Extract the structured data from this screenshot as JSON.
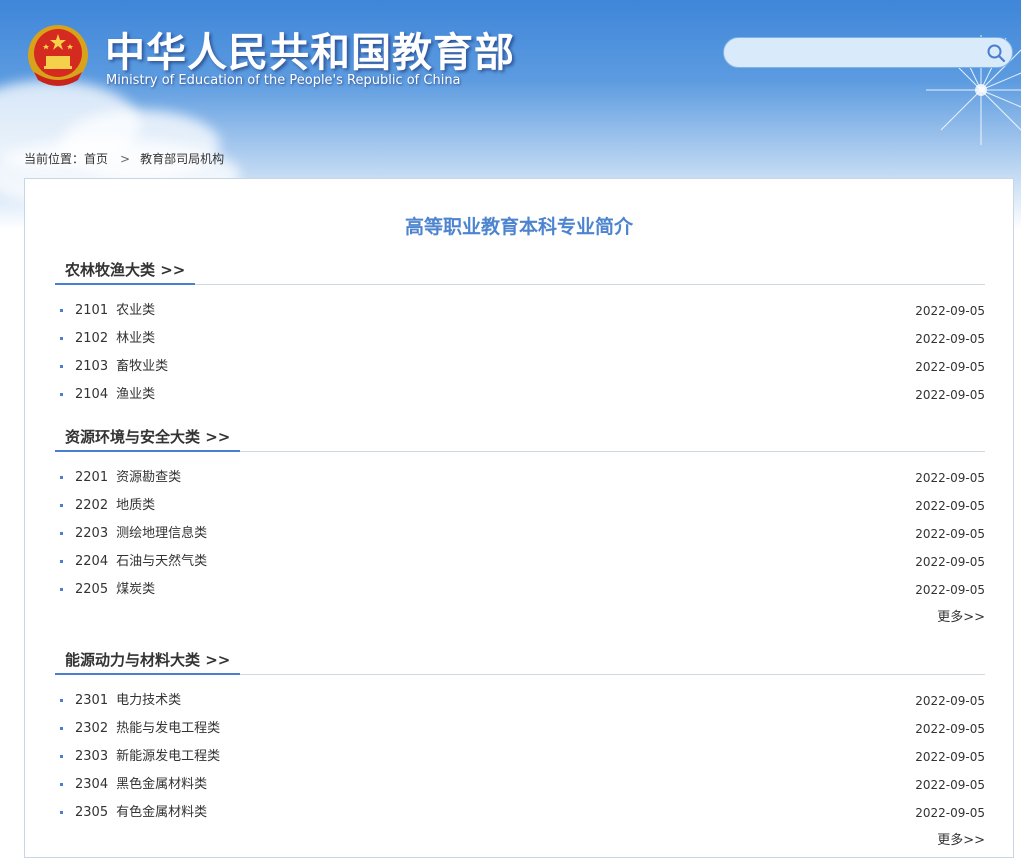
{
  "header": {
    "title": "中华人民共和国教育部",
    "subtitle": "Ministry of Education of the People's Republic of China",
    "search": {
      "value": "",
      "placeholder": ""
    }
  },
  "breadcrumb": {
    "prefix": "当前位置：",
    "home": "首页",
    "separator": ">",
    "current": "教育部司局机构"
  },
  "page_title": "高等职业教育本科专业简介",
  "sections": [
    {
      "title": "农林牧渔大类 >>",
      "items": [
        {
          "code": "2101",
          "name": "农业类",
          "date": "2022-09-05"
        },
        {
          "code": "2102",
          "name": "林业类",
          "date": "2022-09-05"
        },
        {
          "code": "2103",
          "name": "畜牧业类",
          "date": "2022-09-05"
        },
        {
          "code": "2104",
          "name": "渔业类",
          "date": "2022-09-05"
        }
      ]
    },
    {
      "title": "资源环境与安全大类 >>",
      "items": [
        {
          "code": "2201",
          "name": "资源勘查类",
          "date": "2022-09-05"
        },
        {
          "code": "2202",
          "name": "地质类",
          "date": "2022-09-05"
        },
        {
          "code": "2203",
          "name": "测绘地理信息类",
          "date": "2022-09-05"
        },
        {
          "code": "2204",
          "name": "石油与天然气类",
          "date": "2022-09-05"
        },
        {
          "code": "2205",
          "name": "煤炭类",
          "date": "2022-09-05"
        }
      ],
      "more": "更多>>"
    },
    {
      "title": "能源动力与材料大类 >>",
      "items": [
        {
          "code": "2301",
          "name": "电力技术类",
          "date": "2022-09-05"
        },
        {
          "code": "2302",
          "name": "热能与发电工程类",
          "date": "2022-09-05"
        },
        {
          "code": "2303",
          "name": "新能源发电工程类",
          "date": "2022-09-05"
        },
        {
          "code": "2304",
          "name": "黑色金属材料类",
          "date": "2022-09-05"
        },
        {
          "code": "2305",
          "name": "有色金属材料类",
          "date": "2022-09-05"
        }
      ],
      "more": "更多>>"
    }
  ],
  "icons": {
    "emblem": "national-emblem-icon",
    "search": "search-icon"
  },
  "colors": {
    "accent": "#4a7fd0",
    "title": "#4d84cf",
    "header_top": "#3f86d9"
  }
}
